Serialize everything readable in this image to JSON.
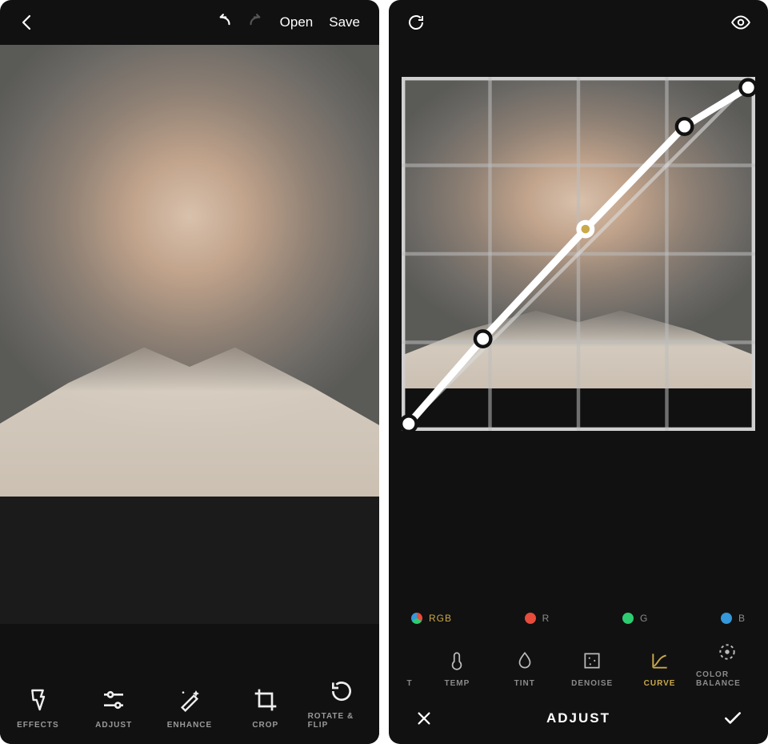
{
  "left": {
    "header": {
      "open": "Open",
      "save": "Save"
    },
    "tools": [
      {
        "key": "effects",
        "label": "EFFECTS"
      },
      {
        "key": "adjust",
        "label": "ADJUST"
      },
      {
        "key": "enhance",
        "label": "ENHANCE"
      },
      {
        "key": "crop",
        "label": "CROP"
      },
      {
        "key": "rotate",
        "label": "ROTATE & FLIP"
      }
    ]
  },
  "right": {
    "channels": [
      {
        "key": "rgb",
        "label": "RGB",
        "active": true
      },
      {
        "key": "r",
        "label": "R"
      },
      {
        "key": "g",
        "label": "G"
      },
      {
        "key": "b",
        "label": "B"
      }
    ],
    "adjust_tools": [
      {
        "key": "edge",
        "label": "T"
      },
      {
        "key": "temp",
        "label": "TEMP"
      },
      {
        "key": "tint",
        "label": "TINT"
      },
      {
        "key": "denoise",
        "label": "DENOISE"
      },
      {
        "key": "curve",
        "label": "CURVE",
        "active": true
      },
      {
        "key": "colorbalance",
        "label": "COLOR BALANCE"
      }
    ],
    "title": "ADJUST",
    "curve_points": [
      {
        "x": 0.02,
        "y": 0.98
      },
      {
        "x": 0.23,
        "y": 0.74
      },
      {
        "x": 0.52,
        "y": 0.43,
        "selected": true
      },
      {
        "x": 0.8,
        "y": 0.14
      },
      {
        "x": 0.98,
        "y": 0.03
      }
    ]
  }
}
